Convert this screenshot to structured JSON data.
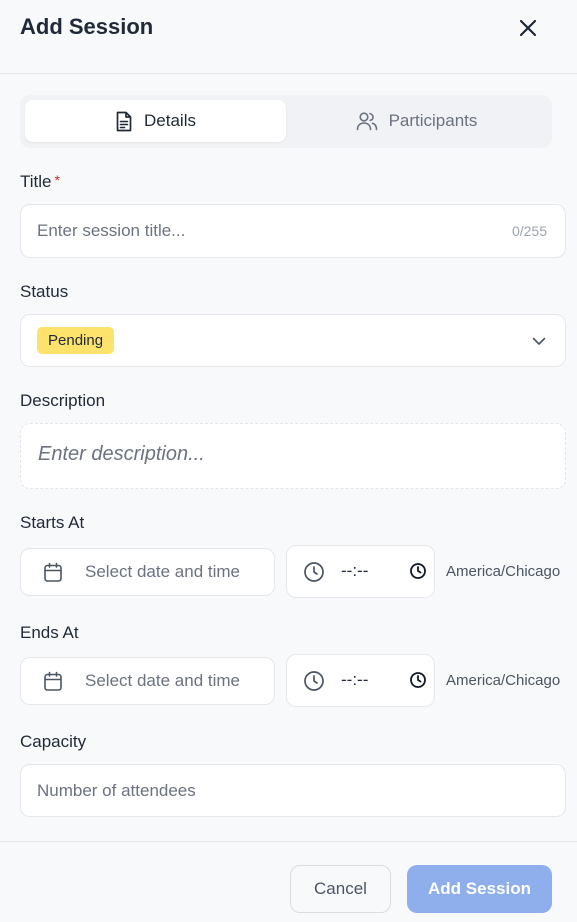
{
  "header": {
    "title": "Add Session"
  },
  "tabs": [
    {
      "label": "Details",
      "icon": "document-icon",
      "active": true
    },
    {
      "label": "Participants",
      "icon": "users-icon",
      "active": false
    }
  ],
  "form": {
    "title": {
      "label": "Title",
      "required_mark": "*",
      "placeholder": "Enter session title...",
      "value": "",
      "counter": "0/255"
    },
    "status": {
      "label": "Status",
      "value": "Pending",
      "badge_color": "#fde36b"
    },
    "description": {
      "label": "Description",
      "placeholder": "Enter description..."
    },
    "starts_at": {
      "label": "Starts At",
      "date_placeholder": "Select date and time",
      "time_value": "--:--",
      "timezone": "America/Chicago"
    },
    "ends_at": {
      "label": "Ends At",
      "date_placeholder": "Select date and time",
      "time_value": "--:--",
      "timezone": "America/Chicago"
    },
    "capacity": {
      "label": "Capacity",
      "placeholder": "Number of attendees",
      "value": ""
    }
  },
  "footer": {
    "cancel_label": "Cancel",
    "submit_label": "Add Session"
  },
  "colors": {
    "primary_disabled": "#8eaeec",
    "required": "#dc2626",
    "background": "#f8f9fb"
  }
}
